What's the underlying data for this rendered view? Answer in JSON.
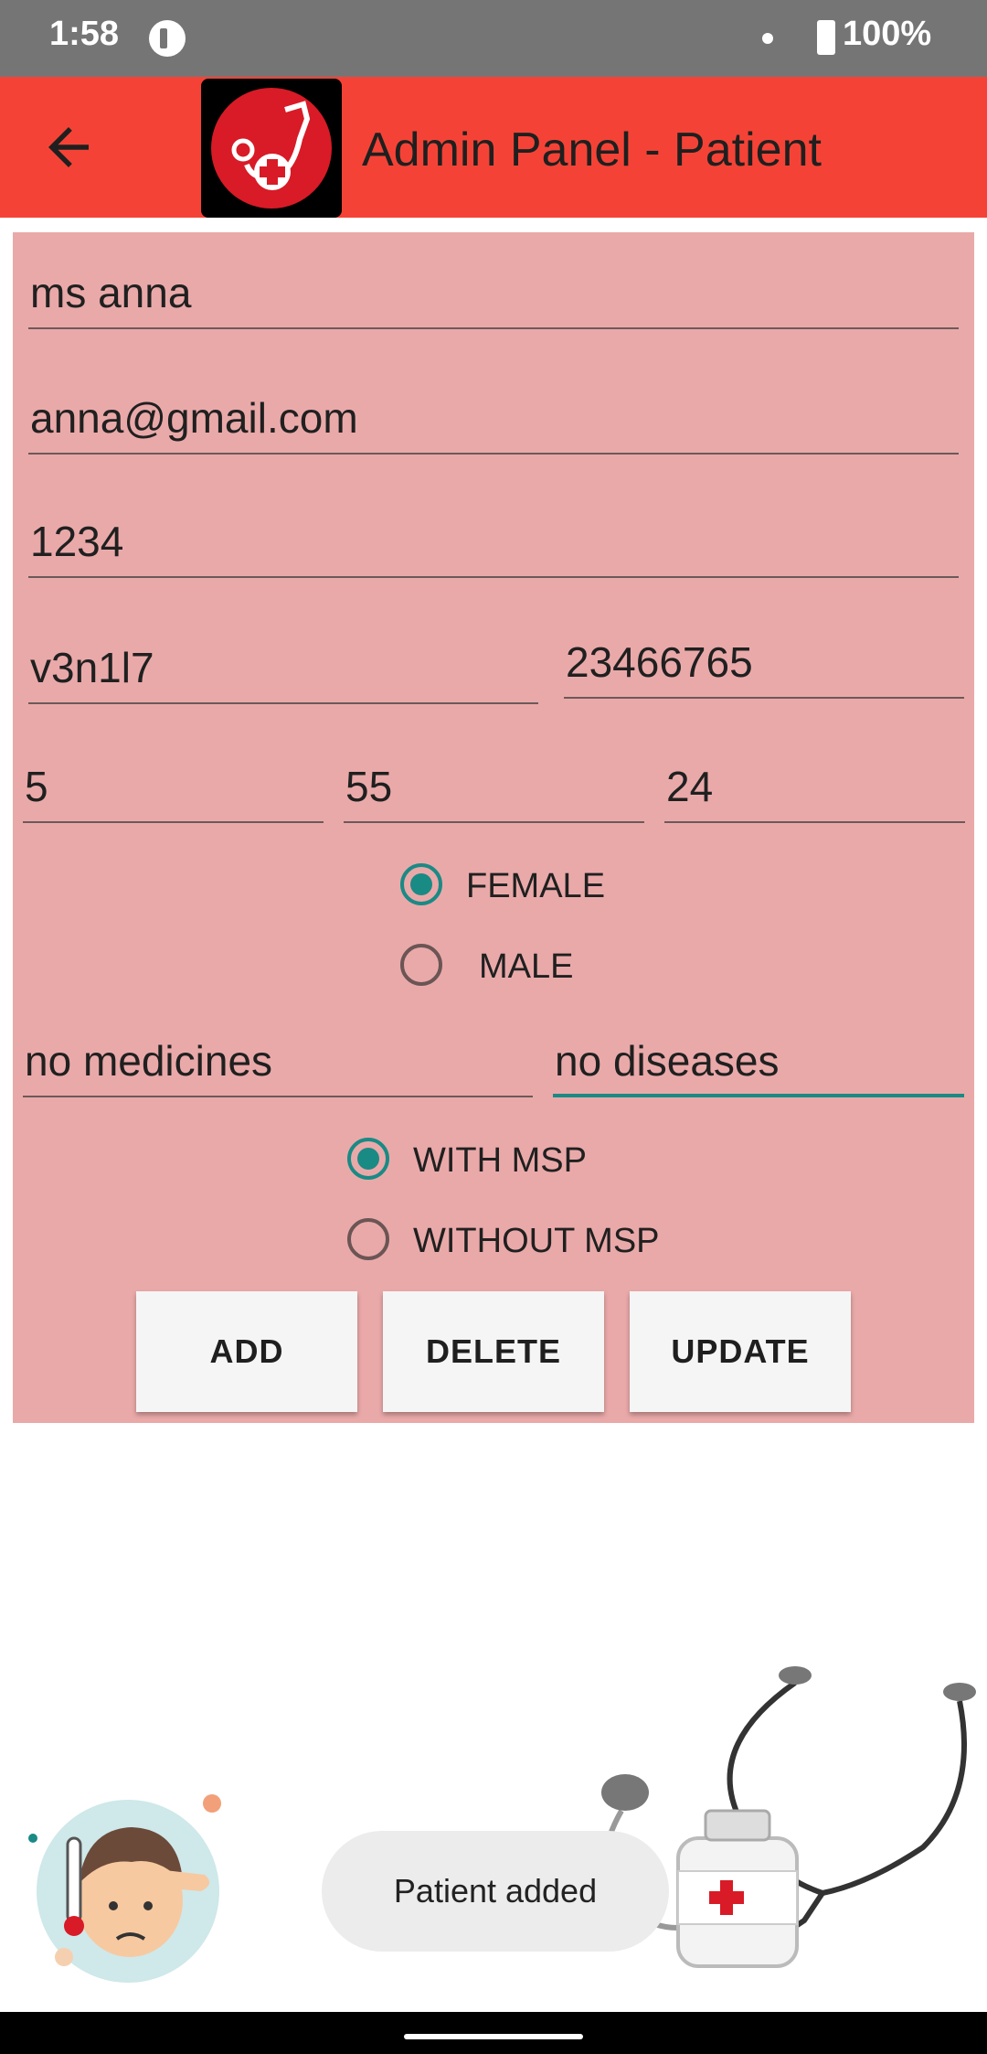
{
  "status_bar": {
    "time": "1:58",
    "battery": "100%"
  },
  "toolbar": {
    "title": "Admin Panel - Patient",
    "icons": [
      "back-arrow-icon",
      "stethoscope-cross-logo"
    ]
  },
  "form": {
    "name": "ms anna",
    "email": "anna@gmail.com",
    "password": "1234",
    "postal_code": "v3n1l7",
    "phone": "23466765",
    "height_feet": "5",
    "weight": "55",
    "age": "24",
    "gender": {
      "options": [
        "FEMALE",
        "MALE"
      ],
      "selected": "FEMALE"
    },
    "medicines": "no medicines",
    "diseases": "no diseases",
    "msp": {
      "options": [
        "WITH MSP",
        "WITHOUT MSP"
      ],
      "selected": "WITH MSP"
    }
  },
  "buttons": {
    "add": "ADD",
    "delete": "DELETE",
    "update": "UPDATE"
  },
  "toast": "Patient added",
  "colors": {
    "toolbar": "#f44336",
    "panel": "#eaa9a9",
    "accent": "#1a8a85",
    "status_bar": "#757575"
  }
}
